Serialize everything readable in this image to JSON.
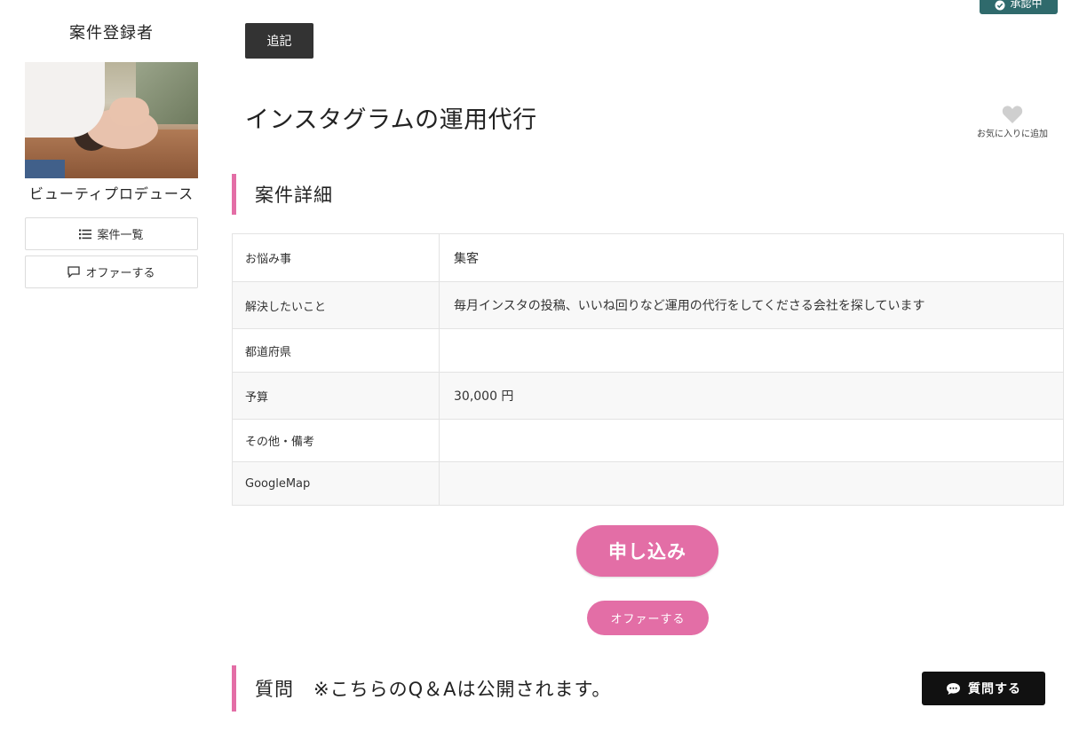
{
  "sidebar": {
    "heading": "案件登録者",
    "registrant_name": "ビューティプロデュース",
    "project_list_label": "案件一覧",
    "offer_label": "オファーする"
  },
  "header": {
    "status_badge": "承認中",
    "append_label": "追記",
    "title": "インスタグラムの運用代行",
    "favorite_label": "お気に入りに追加"
  },
  "details": {
    "heading": "案件詳細",
    "rows": [
      {
        "label": "お悩み事",
        "value": "集客"
      },
      {
        "label": "解決したいこと",
        "value": "毎月インスタの投稿、いいね回りなど運用の代行をしてくださる会社を探しています"
      },
      {
        "label": "都道府県",
        "value": ""
      },
      {
        "label": "予算",
        "value": "30,000 円"
      },
      {
        "label": "その他・備考",
        "value": ""
      },
      {
        "label": "GoogleMap",
        "value": ""
      }
    ]
  },
  "actions": {
    "apply_label": "申し込み",
    "offer_label": "オファーする"
  },
  "qa": {
    "heading": "質問　※こちらのQ＆Aは公開されます。",
    "ask_label": "質問する"
  },
  "colors": {
    "accent_pink": "#e36ea6",
    "badge_teal": "#2f6a6c",
    "dark_button": "#333333"
  },
  "icons": {
    "list": "list-icon",
    "chat": "chat-icon",
    "heart": "heart-icon",
    "check": "check-circle-icon",
    "speech": "speech-bubble-icon"
  }
}
